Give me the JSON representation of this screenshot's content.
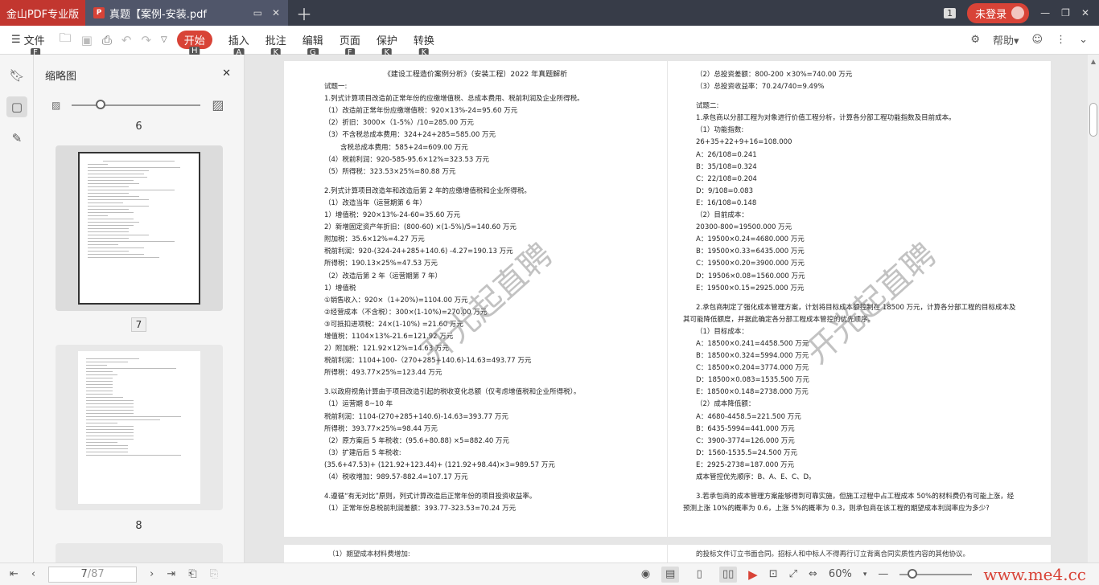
{
  "titlebar": {
    "app": "金山PDF专业版",
    "doc_tab": "真题【案例-安装.pdf",
    "badge": "1",
    "login": "未登录"
  },
  "toolbar": {
    "file": "文件",
    "file_key": "F",
    "menus": [
      {
        "label": "开始",
        "key": "H"
      },
      {
        "label": "插入",
        "key": "A"
      },
      {
        "label": "批注",
        "key": "K"
      },
      {
        "label": "编辑",
        "key": "G"
      },
      {
        "label": "页面",
        "key": "F"
      },
      {
        "label": "保护",
        "key": "K"
      },
      {
        "label": "转换",
        "key": "K"
      }
    ],
    "help": "帮助"
  },
  "thumbs": {
    "title": "缩略图",
    "labels": [
      "6",
      "7",
      "8"
    ]
  },
  "page7": {
    "title": "《建设工程造价案例分析》（安装工程）2022 年真题解析",
    "lines": [
      "试题一:",
      "1.列式计算项目改造前正常年份的应缴增值税、总成本费用、税前利润及企业所得税。",
      "（1）改造前正常年份应缴增值税：920×13%-24=95.60 万元",
      "（2）折旧：3000×（1-5%）/10=285.00 万元",
      "（3）不含税总成本费用：324+24+285=585.00 万元",
      "含税总成本费用：585+24=609.00 万元",
      "（4）税前利润：920-585-95.6×12%=323.53 万元",
      "（5）所得税：323.53×25%=80.88 万元",
      "",
      "2.列式计算项目改造年和改造后第 2 年的应缴增值税和企业所得税。",
      "（1）改造当年（运营期第 6 年）",
      "1）增值税：920×13%-24-60=35.60 万元",
      "2）新增固定资产年折旧：(800-60) ×(1-5%)/5=140.60 万元",
      "附加税：35.6×12%=4.27 万元",
      "税前利润：920-(324-24+285+140.6) -4.27=190.13 万元",
      "所得税：190.13×25%=47.53 万元",
      "（2）改造后第 2 年（运营期第 7 年）",
      "1）增值税",
      "①销售收入：920×（1+20%)=1104.00 万元",
      "②经营成本（不含税）：300×(1-10%)=270.00 万元",
      "③可抵扣进项税：24×(1-10%) =21.60 万元",
      "增值税：1104×13%-21.6=121.92 万元",
      "2）附加税：121.92×12%=14.63 万元",
      "税前利润：1104+100-（270+285+140.6)-14.63=493.77 万元",
      "所得税：493.77×25%=123.44 万元",
      "",
      "3.以政府视角计算由于项目改造引起的税收变化总额（仅考虑增值税和企业所得税）。",
      "（1）运营期 8~10 年",
      "税前利润：1104-(270+285+140.6)-14.63=393.77 万元",
      "所得税：393.77×25%=98.44 万元",
      "（2）原方案后 5 年税收：(95.6+80.88) ×5=882.40 万元",
      "（3）扩建后后 5 年税收:",
      "(35.6+47.53)+ (121.92+123.44)+ (121.92+98.44)×3=989.57 万元",
      "（4）税收增加：989.57-882.4=107.17 万元",
      "",
      "4.遵循“有无对比”原则，列式计算改造后正常年份的项目投资收益率。",
      "（1）正常年份息税前利润差额：393.77-323.53=70.24 万元"
    ]
  },
  "page8": {
    "lines": [
      "（2）总投资差额：800-200 ×30%=740.00 万元",
      "（3）总投资收益率：70.24/740=9.49%",
      "",
      "试题二:",
      "1.承包商以分部工程为对象进行价值工程分析，计算各分部工程功能指数及目前成本。",
      "（1）功能指数:",
      "26+35+22+9+16=108.000",
      "A：26/108=0.241",
      "B：35/108=0.324",
      "C：22/108=0.204",
      "D：9/108=0.083",
      "E：16/108=0.148",
      "（2）目前成本：",
      "20300-800=19500.000 万元",
      "A：19500×0.24=4680.000 万元",
      "B：19500×0.33=6435.000 万元",
      "C：19500×0.20=3900.000 万元",
      "D：19506×0.08=1560.000 万元",
      "E：19500×0.15=2925.000 万元",
      "",
      "2.承包商制定了强化成本管理方案，计划将目标成本额控制在 18500 万元，计算各分部工程的目标成本及",
      "其可能降低额度，并据此确定各分部工程成本管控的优先顺序。",
      "（1）目标成本：",
      "A：18500×0.241=4458.500 万元",
      "B：18500×0.324=5994.000 万元",
      "C：18500×0.204=3774.000 万元",
      "D：18500×0.083=1535.500 万元",
      "E：18500×0.148=2738.000 万元",
      "（2）成本降低额：",
      "A：4680-4458.5=221.500 万元",
      "B：6435-5994=441.000 万元",
      "C：3900-3774=126.000 万元",
      "D：1560-1535.5=24.500 万元",
      "E：2925-2738=187.000 万元",
      "成本管控优先顺序：B、A、E、C、D。",
      "",
      "3.若承包商的成本管理方案能够得到可靠实施，但施工过程中占工程成本 50%的材料费仍有可能上涨，经",
      "预测上涨 10%的概率为 0.6，上涨 5%的概率为 0.3，则承包商在该工程的期望成本利润率应为多少?"
    ]
  },
  "page9": {
    "line": "（1）期望成本材料费增加:"
  },
  "page10": {
    "line": "的投标文件订立书面合同。招标人和中标人不得再行订立背离合同实质性内容的其他协议。"
  },
  "watermark": "开光起直聘",
  "status": {
    "page": "7",
    "total": "/87",
    "zoom": "60%",
    "brand": "www.me4.cc"
  }
}
